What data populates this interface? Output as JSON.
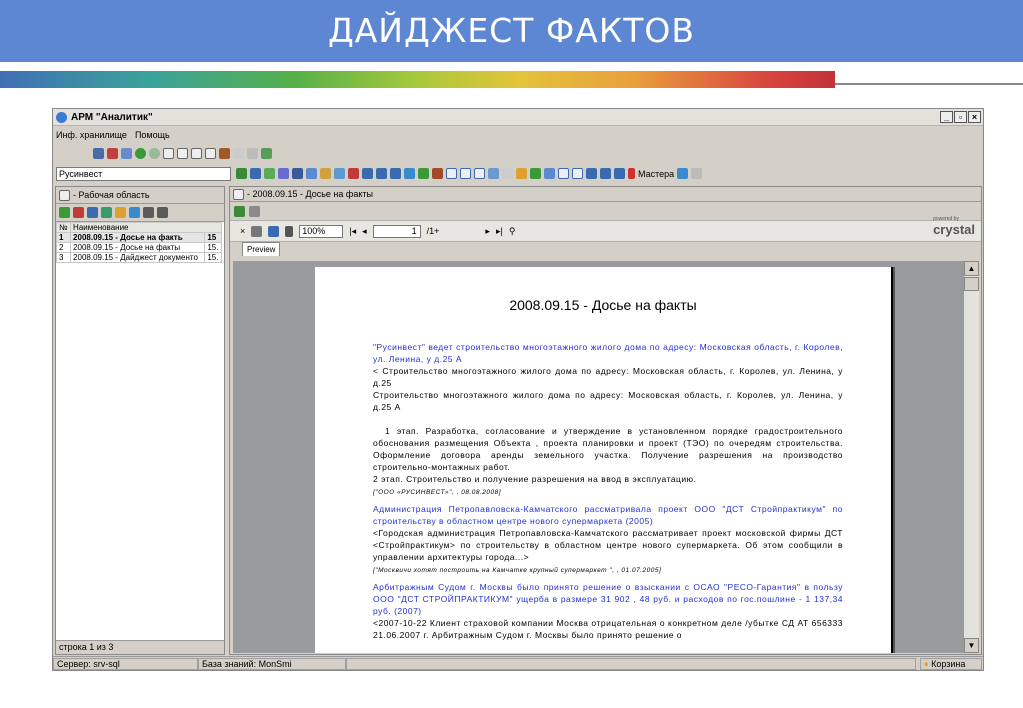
{
  "banner_title": "ДАЙДЖЕСТ ФАКТОВ",
  "app": {
    "title": "АРМ \"Аналитик\"",
    "menu": [
      "Инф. хранилище",
      "Помощь"
    ],
    "search_value": "Русинвест",
    "mastera_label": "Мастера"
  },
  "left": {
    "header": "- Рабочая область",
    "table": {
      "headers": [
        "№",
        "Наименование"
      ],
      "rows": [
        {
          "num": "1",
          "name": "2008.09.15 - Досье на факть",
          "ext": "15"
        },
        {
          "num": "2",
          "name": "2008.09.15 - Досье на факты",
          "ext": "15."
        },
        {
          "num": "3",
          "name": "2008.09.15 - Дайджест документо",
          "ext": "15."
        }
      ]
    },
    "status": "строка 1 из 3"
  },
  "right": {
    "header": "- 2008.09.15 - Досье на факты",
    "zoom": "100%",
    "page_value": "1",
    "page_total": "/1+",
    "powered_by": "powered by",
    "crystal": "crystal",
    "tab": "Preview"
  },
  "document": {
    "title": "2008.09.15 - Досье на факты",
    "p1_head": "\"Русинвест\" ведет строительство многоэтажного жилого дома по адресу: Московская область, г. Королев, ул. Ленина, у д.25 А",
    "p1_body": "< Строительство многоэтажного жилого дома по адресу: Московская область, г. Королев, ул. Ленина, у д.25",
    "p1_body2": "Строительство многоэтажного жилого дома по адресу: Московская область, г. Королев, ул. Ленина, у д.25 А",
    "p2_body": "1 этап. Разработка, согласование и утверждение в установленном порядке градостроительного обоснования размещения Объекта , проекта планировки и проект (ТЭО) по очередям строительства. Оформление договора аренды земельного участка. Получение разрешения на производство строительно-монтажных работ.",
    "p2_body2": "2 этап. Строительство и получение разрешения на ввод в эксплуатацию.",
    "p2_src": "[\"ООО «РУСИНВЕСТ»\", , 08.08.2008]",
    "p3_head": "Администрация Петропавловска-Камчатского рассматривала проект ООО \"ДСТ Стройпрактикум\" по строительству в областном центре нового супермаркета (2005)",
    "p3_body": "<Городская администрация Петропавловска-Камчатского рассматривает проект московской фирмы ДСТ <Стройпрактикум> по строительству в областном центре нового супермаркета. Об этом сообщили в управлении архитектуры города...>",
    "p3_src": "[\"Москвичи хотят построить на Камчатке крупный супермаркет \", , 01.07.2005]",
    "p4_head": "Арбитражным Судом г. Москвы было принято решение о взыскании с ОСАО \"РЕСО-Гарантия\" в пользу ООО \"ДСТ СТРОЙПРАКТИКУМ\" ущерба в размере 31 902 , 48 руб. и расходов по гос.пошлине - 1 137,34 руб. (2007)",
    "p4_body": "<2007-10-22 Клиент страховой компании Москва отрицательная о конкретном деле /убытке СД АТ 656333 21.06.2007 г. Арбитражным Судом г. Москвы было принято решение о"
  },
  "statusbar": {
    "server": "Сервер: srv-sql",
    "kb": "База знаний: MonSmi",
    "basket": "Корзина"
  },
  "colors": {
    "banner": "#5d86d3",
    "link_text": "#2233cc"
  }
}
